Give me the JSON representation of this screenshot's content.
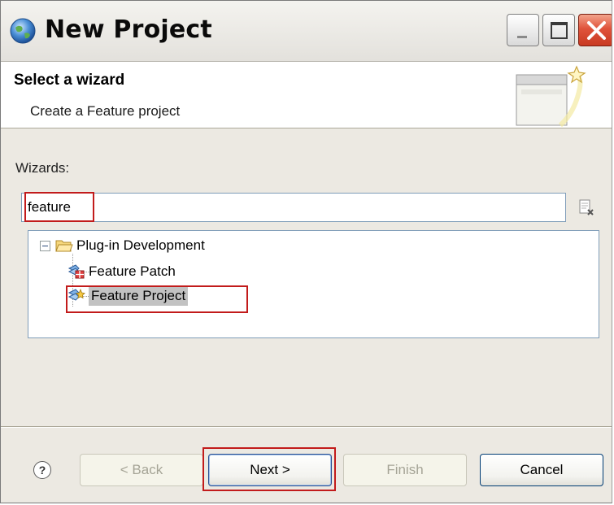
{
  "window": {
    "title": "New Project",
    "controls": [
      "minimize",
      "maximize",
      "close"
    ]
  },
  "header": {
    "title": "Select a wizard",
    "description": "Create a Feature project"
  },
  "wizards": {
    "label": "Wizards:",
    "filter_value": "feature",
    "clear_icon": "clear-filter-icon"
  },
  "tree": {
    "root": {
      "label": "Plug-in Development",
      "expanded": true,
      "icon": "folder-open-icon"
    },
    "children": [
      {
        "label": "Feature Patch",
        "icon": "feature-patch-icon",
        "selected": false
      },
      {
        "label": "Feature Project",
        "icon": "feature-project-icon",
        "selected": true
      }
    ]
  },
  "footer": {
    "help": "?",
    "back_label": "< Back",
    "next_label": "Next >",
    "finish_label": "Finish",
    "cancel_label": "Cancel",
    "back_enabled": false,
    "finish_enabled": false
  },
  "colors": {
    "dialog_bg": "#ece9e2",
    "highlight_box": "#c21b1b",
    "selection": "#c2c2c2",
    "close_button": "#d94a33"
  }
}
